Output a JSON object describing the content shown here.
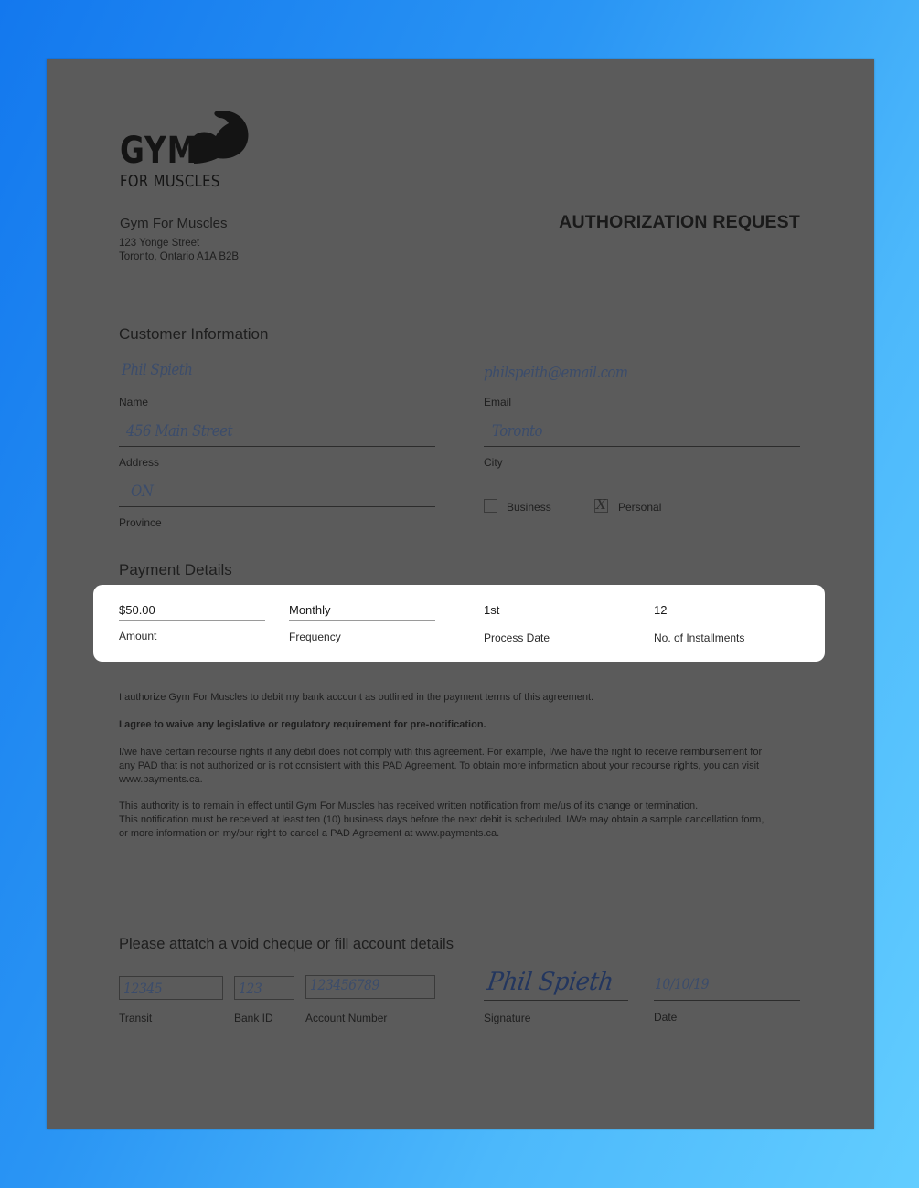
{
  "colors": {
    "background_start": "#1378ee",
    "background_end": "#62cdff",
    "page": "#5b5b5b",
    "handwriting": "#3b4c6b",
    "highlight_card": "#ffffff"
  },
  "logo": {
    "word": "GYM",
    "subtitle": "FOR MUSCLES",
    "icon": "flexed-arm-icon"
  },
  "company": {
    "name": "Gym For Muscles",
    "address_line1": "123 Yonge Street",
    "address_line2": "Toronto, Ontario A1A B2B"
  },
  "document_title": "AUTHORIZATION REQUEST",
  "customer_info": {
    "heading": "Customer Information",
    "name": {
      "value": "Phil Spieth",
      "label": "Name"
    },
    "email": {
      "value": "philspeith@email.com",
      "label": "Email"
    },
    "address": {
      "value": "456 Main Street",
      "label": "Address"
    },
    "city": {
      "value": "Toronto",
      "label": "City"
    },
    "province": {
      "value": "ON",
      "label": "Province"
    },
    "account_type": {
      "business": {
        "label": "Business",
        "checked": false
      },
      "personal": {
        "label": "Personal",
        "checked": true,
        "mark": "X"
      }
    }
  },
  "payment_details": {
    "heading": "Payment Details",
    "amount": {
      "value": "$50.00",
      "label": "Amount"
    },
    "frequency": {
      "value": "Monthly",
      "label": "Frequency"
    },
    "process_date": {
      "value": "1st",
      "label": "Process Date"
    },
    "installments": {
      "value": "12",
      "label": "No. of Installments"
    }
  },
  "terms": {
    "p1": "I authorize Gym For Muscles to debit my bank account as outlined in the payment terms of this agreement.",
    "p2": "I agree to waive any legislative or regulatory requirement for pre-notification.",
    "p3_line1": "I/we have certain recourse rights if any debit does not comply with this agreement. For example, I/we have the right to receive reimbursement for",
    "p3_line2": "any PAD that is not authorized or is not consistent with this PAD Agreement. To obtain more information about your recourse rights, you can visit",
    "p3_line3": "www.payments.ca.",
    "p4_line1": "This authority is to remain in effect until Gym For Muscles has received written notification from me/us of its change or termination.",
    "p4_line2": "This notification must be received at least ten (10) business days before the next debit is scheduled. I/We may obtain a sample cancellation form,",
    "p4_line3": "or more information on my/our right to cancel a PAD Agreement at www.payments.ca."
  },
  "account_details": {
    "heading": "Please attatch a void cheque or fill account details",
    "transit": {
      "value": "12345",
      "label": "Transit"
    },
    "bank_id": {
      "value": "123",
      "label": "Bank ID"
    },
    "account_number": {
      "value": "123456789",
      "label": "Account Number"
    },
    "signature": {
      "value": "Phil Spieth",
      "label": "Signature"
    },
    "date": {
      "value": "10/10/19",
      "label": "Date"
    }
  }
}
